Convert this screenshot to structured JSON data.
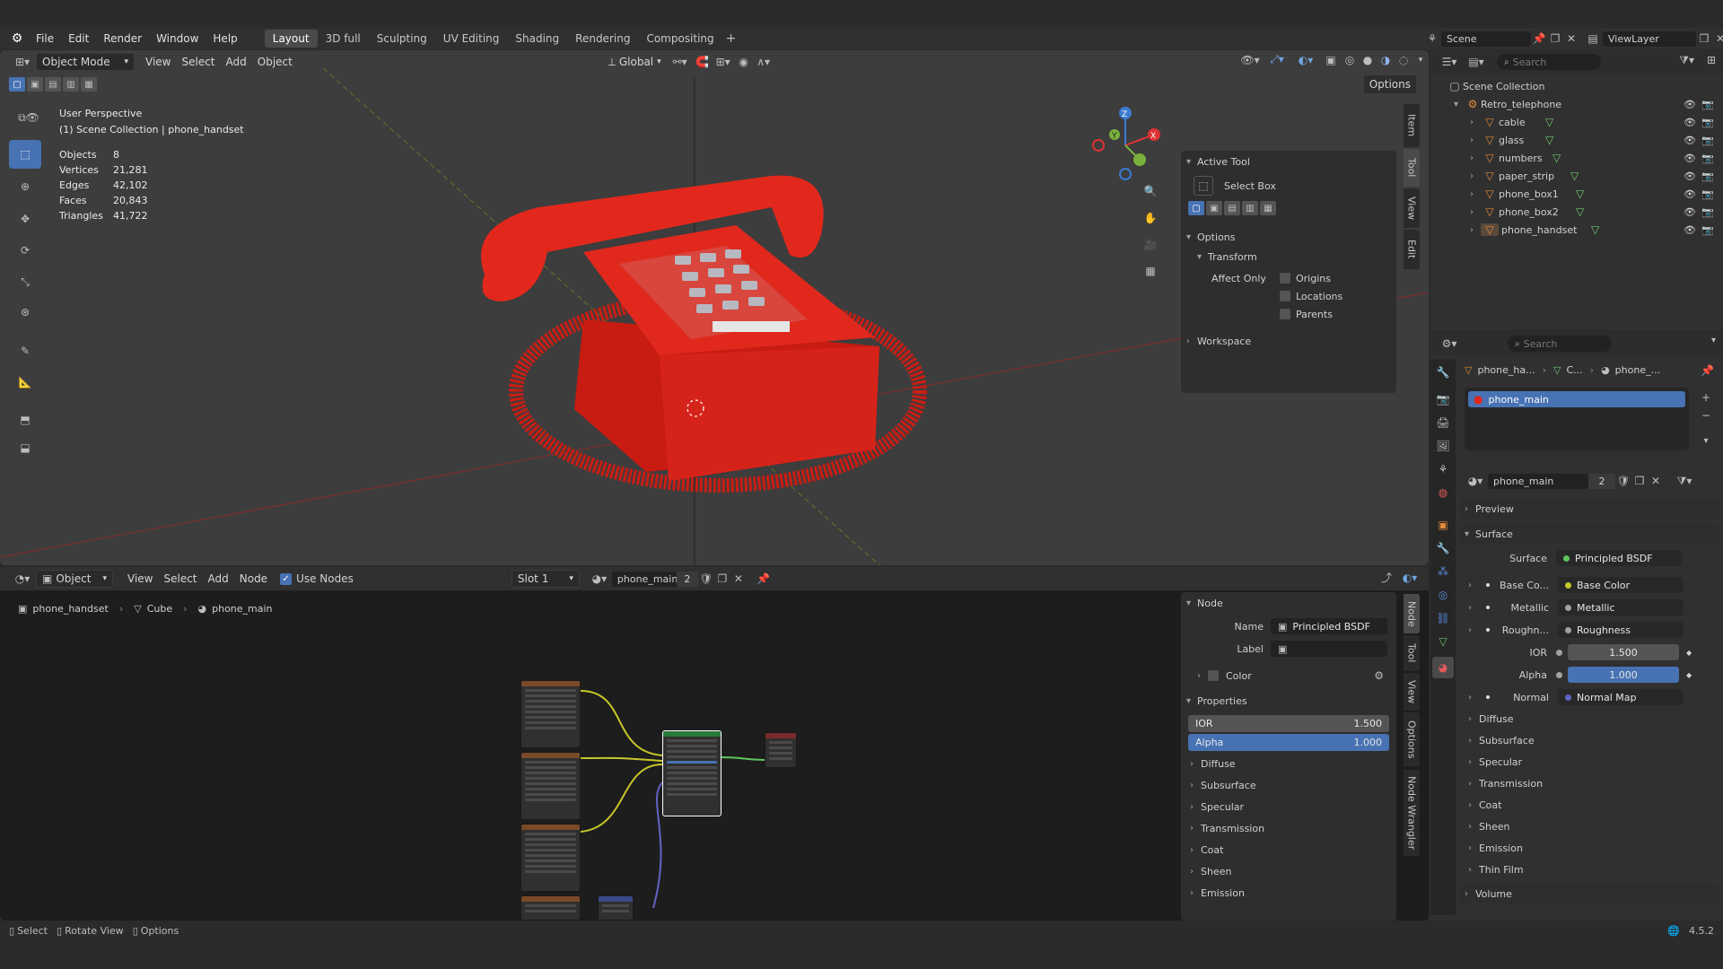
{
  "menus": [
    "File",
    "Edit",
    "Render",
    "Window",
    "Help"
  ],
  "workspaces": [
    "Layout",
    "3D full",
    "Sculpting",
    "UV Editing",
    "Shading",
    "Rendering",
    "Compositing"
  ],
  "scene": {
    "label": "Scene",
    "viewlayer": "ViewLayer"
  },
  "viewport": {
    "mode": "Object Mode",
    "menus": [
      "View",
      "Select",
      "Add",
      "Object"
    ],
    "orientation": "Global",
    "options": "Options",
    "perspective": "User Perspective",
    "collection_line": "(1) Scene Collection | phone_handset",
    "stats": [
      {
        "k": "Objects",
        "v": "8"
      },
      {
        "k": "Vertices",
        "v": "21,281"
      },
      {
        "k": "Edges",
        "v": "42,102"
      },
      {
        "k": "Faces",
        "v": "20,843"
      },
      {
        "k": "Triangles",
        "v": "41,722"
      }
    ]
  },
  "n_panel": {
    "active_tool": "Active Tool",
    "tool_name": "Select Box",
    "options": "Options",
    "transform": "Transform",
    "affect_only": "Affect Only",
    "checks": [
      "Origins",
      "Locations",
      "Parents"
    ],
    "workspace": "Workspace",
    "tabs": [
      "Item",
      "Tool",
      "View",
      "Edit"
    ]
  },
  "outliner": {
    "search": "Search",
    "root": "Scene Collection",
    "collection": "Retro_telephone",
    "objects": [
      "cable",
      "glass",
      "numbers",
      "paper_strip",
      "phone_box1",
      "phone_box2",
      "phone_handset"
    ]
  },
  "properties": {
    "search": "Search",
    "breadcrumb": [
      "phone_ha...",
      "C...",
      "phone_..."
    ],
    "slot": "phone_main",
    "material": "phone_main",
    "users": "2",
    "sections": {
      "preview": "Preview",
      "surface": "Surface"
    },
    "surface": {
      "label": "Surface",
      "value": "Principled BSDF"
    },
    "inputs": [
      {
        "label": "Base Co...",
        "value": "Base Color",
        "color": "#c7c729"
      },
      {
        "label": "Metallic",
        "value": "Metallic",
        "color": "#a1a1a1"
      },
      {
        "label": "Roughn...",
        "value": "Roughness",
        "color": "#a1a1a1"
      }
    ],
    "ior": {
      "label": "IOR",
      "value": "1.500"
    },
    "alpha": {
      "label": "Alpha",
      "value": "1.000"
    },
    "normal": {
      "label": "Normal",
      "value": "Normal Map",
      "color": "#6363c7"
    },
    "subs": [
      "Diffuse",
      "Subsurface",
      "Specular",
      "Transmission",
      "Coat",
      "Sheen",
      "Emission",
      "Thin Film"
    ],
    "volume": "Volume"
  },
  "node_editor": {
    "type": "Object",
    "menus": [
      "View",
      "Select",
      "Add",
      "Node"
    ],
    "use_nodes": "Use Nodes",
    "slot": "Slot 1",
    "material": "phone_main",
    "users": "2",
    "breadcrumb": [
      "phone_handset",
      "Cube",
      "phone_main"
    ]
  },
  "node_panel": {
    "node": "Node",
    "name_label": "Name",
    "name_value": "Principled BSDF",
    "label_label": "Label",
    "color": "Color",
    "properties": "Properties",
    "ior": {
      "label": "IOR",
      "value": "1.500"
    },
    "alpha": {
      "label": "Alpha",
      "value": "1.000"
    },
    "subs": [
      "Diffuse",
      "Subsurface",
      "Specular",
      "Transmission",
      "Coat",
      "Sheen",
      "Emission"
    ],
    "tabs": [
      "Node",
      "Tool",
      "View",
      "Options",
      "Node Wrangler"
    ]
  },
  "statusbar": {
    "items": [
      "Select",
      "Rotate View",
      "Options"
    ],
    "version": "4.5.2"
  },
  "colors": {
    "accent": "#4772b3",
    "phone": "#e0251b",
    "grid_x": "#8a2b2b",
    "grid_y": "#5a7a2a"
  }
}
